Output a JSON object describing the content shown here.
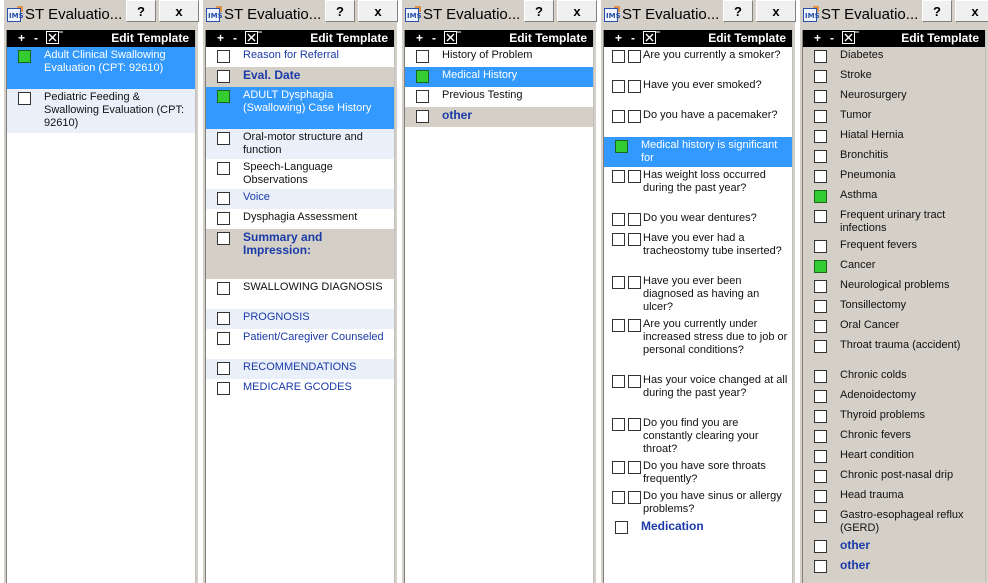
{
  "colors": {
    "selected": "#3399ff",
    "checked": "#33cc33",
    "toolbar": "#000000",
    "link": "#1a3aa8"
  },
  "icons": {
    "app": "ims-app-icon",
    "delete": "delete-box-icon"
  },
  "panels": [
    {
      "title": "ST Evaluatio...",
      "help": "?",
      "close": "x",
      "toolbar": {
        "plus": "+",
        "minus": "-",
        "edit": "Edit Template"
      },
      "rows": [
        {
          "label": "Adult Clinical Swallowing Evaluation (CPT: 92610)",
          "checked": true,
          "selected": true
        },
        {
          "label": "Pediatric Feeding & Swallowing Evaluation (CPT: 92610)",
          "checked": false,
          "style": "alt"
        }
      ]
    },
    {
      "title": "ST Evaluatio...",
      "help": "?",
      "close": "x",
      "toolbar": {
        "plus": "+",
        "minus": "-",
        "edit": "Edit Template"
      },
      "rows": [
        {
          "label": "Reason for Referral",
          "style": "link"
        },
        {
          "label": "Eval. Date",
          "style": "bold gray"
        },
        {
          "label": "ADULT Dysphagia (Swallowing) Case History",
          "checked": true,
          "selected": true
        },
        {
          "label": "Oral-motor structure and function",
          "style": "alt"
        },
        {
          "label": "Speech-Language Observations"
        },
        {
          "label": "Voice",
          "style": "link alt"
        },
        {
          "label": "Dysphagia Assessment"
        },
        {
          "label": "Summary and Impression:",
          "style": "bold gray"
        },
        {
          "label": "SWALLOWING DIAGNOSIS"
        },
        {
          "label": "PROGNOSIS",
          "style": "link alt"
        },
        {
          "label": "Patient/Caregiver Counseled",
          "style": "link"
        },
        {
          "label": "RECOMMENDATIONS",
          "style": "link alt"
        },
        {
          "label": "MEDICARE GCODES",
          "style": "link"
        }
      ]
    },
    {
      "title": "ST Evaluatio...",
      "help": "?",
      "close": "x",
      "toolbar": {
        "plus": "+",
        "minus": "-",
        "edit": "Edit Template"
      },
      "rows": [
        {
          "label": "History of Problem"
        },
        {
          "label": "Medical History",
          "checked": true,
          "selected": true
        },
        {
          "label": "Previous Testing"
        },
        {
          "label": "other",
          "style": "bold gray"
        }
      ]
    },
    {
      "title": "ST Evaluatio...",
      "help": "?",
      "close": "x",
      "toolbar": {
        "plus": "+",
        "minus": "-",
        "edit": "Edit Template"
      },
      "rows": [
        {
          "label": "Are you currently a smoker?",
          "double": true
        },
        {
          "label": "Have you ever smoked?",
          "double": true
        },
        {
          "label": "Do you have a pacemaker?",
          "double": true
        },
        {
          "label": "Medical history is significant for",
          "checked": true,
          "selected": true
        },
        {
          "label": "Has weight loss occurred during the past year?",
          "double": true
        },
        {
          "label": "Do you wear dentures?",
          "double": true
        },
        {
          "label": "Have you ever had a tracheostomy tube inserted?",
          "double": true
        },
        {
          "label": "Have you ever been diagnosed as having an ulcer?",
          "double": true
        },
        {
          "label": "Are you currently under increased stress due to job or personal conditions?",
          "double": true
        },
        {
          "label": "Has your voice changed at all during the past year?",
          "double": true
        },
        {
          "label": "Do you find you are constantly clearing your throat?",
          "double": true
        },
        {
          "label": "Do you have sore throats frequently?",
          "double": true
        },
        {
          "label": "Do you have sinus or allergy problems?",
          "double": true
        },
        {
          "label": "Medication",
          "style": "bold"
        }
      ]
    },
    {
      "title": "ST Evaluatio...",
      "help": "?",
      "close": "x",
      "toolbar": {
        "plus": "+",
        "minus": "-",
        "edit": "Edit Template"
      },
      "rows": [
        {
          "label": "Diabetes"
        },
        {
          "label": "Stroke"
        },
        {
          "label": "Neurosurgery"
        },
        {
          "label": "Tumor"
        },
        {
          "label": "Hiatal Hernia"
        },
        {
          "label": "Bronchitis"
        },
        {
          "label": "Pneumonia"
        },
        {
          "label": "Asthma",
          "checked": true
        },
        {
          "label": "Frequent urinary tract infections"
        },
        {
          "label": "Frequent fevers"
        },
        {
          "label": "Cancer",
          "checked": true
        },
        {
          "label": "Neurological problems"
        },
        {
          "label": "Tonsillectomy"
        },
        {
          "label": "Oral Cancer"
        },
        {
          "label": "Throat trauma (accident)"
        },
        {
          "label": "Chronic colds"
        },
        {
          "label": "Adenoidectomy"
        },
        {
          "label": "Thyroid problems"
        },
        {
          "label": "Chronic fevers"
        },
        {
          "label": "Heart condition"
        },
        {
          "label": "Chronic post-nasal drip"
        },
        {
          "label": "Head trauma"
        },
        {
          "label": "Gastro-esophageal reflux (GERD)"
        },
        {
          "label": "other",
          "style": "bold"
        },
        {
          "label": "other",
          "style": "bold"
        }
      ]
    }
  ]
}
